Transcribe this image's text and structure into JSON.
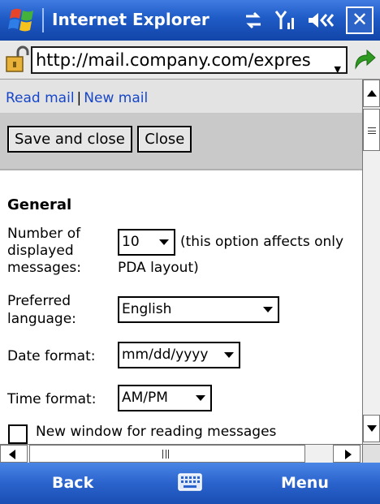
{
  "titlebar": {
    "app_title": "Internet Explorer",
    "close_label": "✕"
  },
  "address": {
    "url": "http://mail.company.com/expres"
  },
  "links": {
    "read_mail": "Read mail",
    "separator": "|",
    "new_mail": "New mail"
  },
  "actions": {
    "save_and_close": "Save and close",
    "close": "Close"
  },
  "form": {
    "section_title": "General",
    "num_messages_label_1": "Number of",
    "num_messages_label_2": "displayed",
    "num_messages_label_3": "messages:",
    "num_messages_value": "10",
    "num_messages_note_1": "(this option affects only",
    "num_messages_note_2": "PDA layout)",
    "language_label_1": "Preferred",
    "language_label_2": "language:",
    "language_value": "English",
    "date_format_label": "Date format:",
    "date_format_value": "mm/dd/yyyy",
    "time_format_label": "Time format:",
    "time_format_value": "AM/PM",
    "new_window_label": "New window for reading messages"
  },
  "softkeys": {
    "left": "Back",
    "right": "Menu"
  },
  "colors": {
    "titlebar": "#1f5bc6",
    "link": "#1747c8",
    "go_arrow": "#2e9a22"
  }
}
